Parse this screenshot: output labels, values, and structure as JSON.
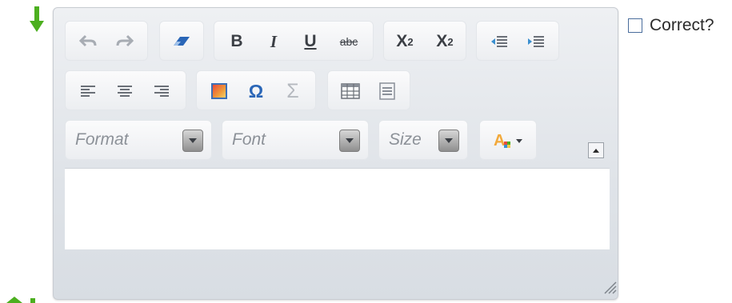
{
  "toolbar": {
    "format_placeholder": "Format",
    "font_placeholder": "Font",
    "size_placeholder": "Size",
    "bold": "B",
    "italic": "I",
    "underline": "U",
    "strike": "abc",
    "subscript_base": "X",
    "subscript_mark": "2",
    "superscript_base": "X",
    "superscript_mark": "2",
    "omega": "Ω",
    "sigma": "Σ"
  },
  "correct_label": "Correct?",
  "colors": {
    "accent_green": "#4caf1f",
    "outdent_blue": "#3a8fd0"
  }
}
